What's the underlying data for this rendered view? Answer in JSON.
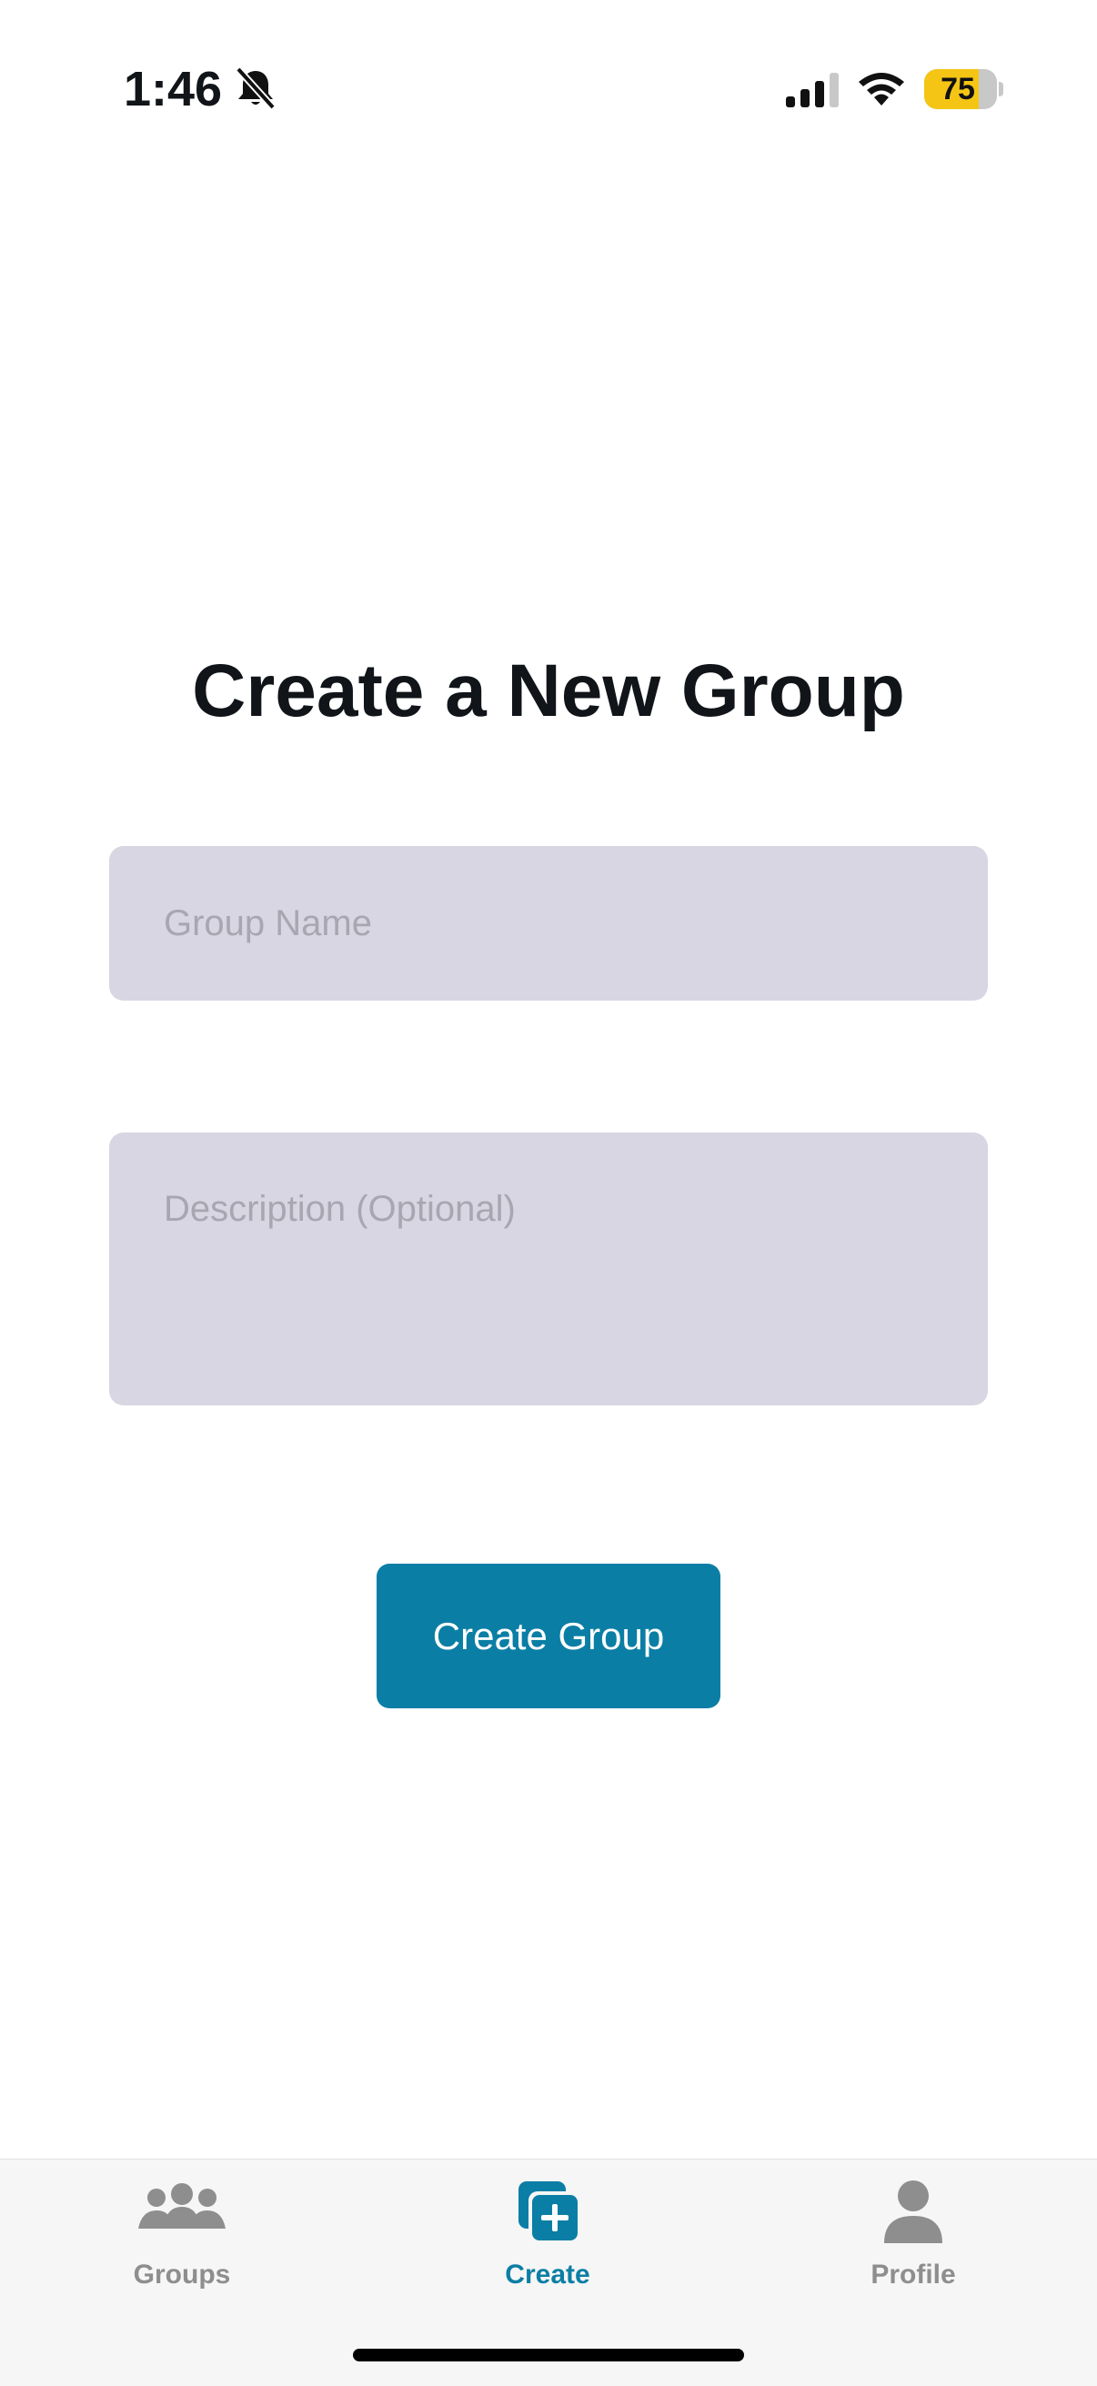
{
  "status_bar": {
    "time": "1:46",
    "battery_percent": "75",
    "battery_level": 0.75,
    "icons": [
      "bell-slash-icon",
      "signal-icon",
      "wifi-icon",
      "battery-icon"
    ]
  },
  "page": {
    "title": "Create a New Group"
  },
  "form": {
    "name_placeholder": "Group Name",
    "name_value": "",
    "description_placeholder": "Description (Optional)",
    "description_value": "",
    "submit_label": "Create Group"
  },
  "tab_bar": {
    "active": "Create",
    "items": [
      {
        "label": "Groups",
        "icon": "groups-icon"
      },
      {
        "label": "Create",
        "icon": "create-icon"
      },
      {
        "label": "Profile",
        "icon": "profile-icon"
      }
    ]
  },
  "colors": {
    "accent": "#0b7ea5",
    "field_bg": "#d8d6e2",
    "placeholder": "#a7a6b1",
    "inactive_tab": "#8e8e8e",
    "battery": "#f4c514"
  }
}
